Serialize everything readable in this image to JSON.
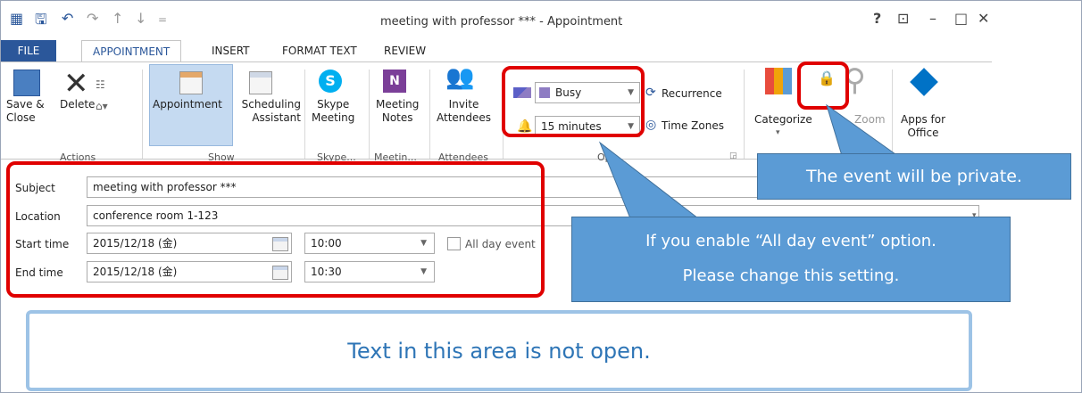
{
  "window": {
    "title": "meeting with professor *** - Appointment",
    "help": "?",
    "restore": "⊡",
    "minimize": "–",
    "maximize": "□",
    "close": "✕"
  },
  "tabs": [
    "FILE",
    "APPOINTMENT",
    "INSERT",
    "FORMAT TEXT",
    "REVIEW"
  ],
  "ribbon": {
    "save_close": "Save &\nClose",
    "delete": "Delete",
    "appointment": "Appointment",
    "scheduling": "Scheduling\nAssistant",
    "skype": "Skype\nMeeting",
    "meeting_notes": "Meeting\nNotes",
    "invite": "Invite\nAttendees",
    "show_as": "Busy",
    "reminder": "15 minutes",
    "recurrence": "Recurrence",
    "time_zones": "Time Zones",
    "categorize": "Categorize",
    "zoom": "Zoom",
    "apps": "Apps for\nOffice",
    "groups": {
      "actions": "Actions",
      "show": "Show",
      "skype": "Skype...",
      "meeting": "Meetin...",
      "attendees": "Attendees",
      "options": "Opt"
    }
  },
  "form": {
    "subject_label": "Subject",
    "subject": "meeting with professor ***",
    "location_label": "Location",
    "location": "conference room 1-123",
    "start_label": "Start time",
    "start_date": "2015/12/18 (金)",
    "start_time": "10:00",
    "end_label": "End time",
    "end_date": "2015/12/18 (金)",
    "end_time": "10:30",
    "all_day": "All day event"
  },
  "annotations": {
    "private": "The event will be private.",
    "all_day_line1": "If you enable “All day event” option.",
    "all_day_line2": "Please change this setting.",
    "body": "Text in this area is not open."
  },
  "colors": {
    "brand": "#2b579a",
    "callout": "#5b9bd5",
    "highlight": "#e00000",
    "busy": "#8e7cc3"
  }
}
